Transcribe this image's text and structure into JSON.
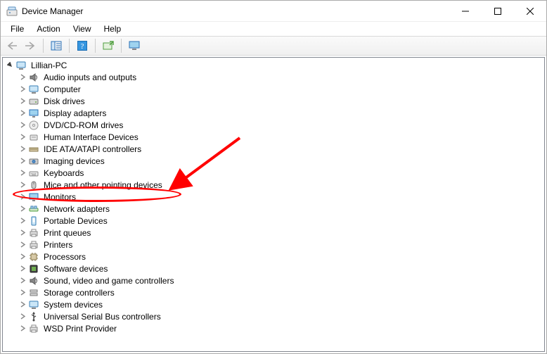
{
  "window": {
    "title": "Device Manager"
  },
  "menu": {
    "file": "File",
    "action": "Action",
    "view": "View",
    "help": "Help"
  },
  "tree": {
    "root": "Lillian-PC",
    "items": [
      "Audio inputs and outputs",
      "Computer",
      "Disk drives",
      "Display adapters",
      "DVD/CD-ROM drives",
      "Human Interface Devices",
      "IDE ATA/ATAPI controllers",
      "Imaging devices",
      "Keyboards",
      "Mice and other pointing devices",
      "Monitors",
      "Network adapters",
      "Portable Devices",
      "Print queues",
      "Printers",
      "Processors",
      "Software devices",
      "Sound, video and game controllers",
      "Storage controllers",
      "System devices",
      "Universal Serial Bus controllers",
      "WSD Print Provider"
    ]
  },
  "annotation": {
    "highlighted_item_index": 9
  }
}
